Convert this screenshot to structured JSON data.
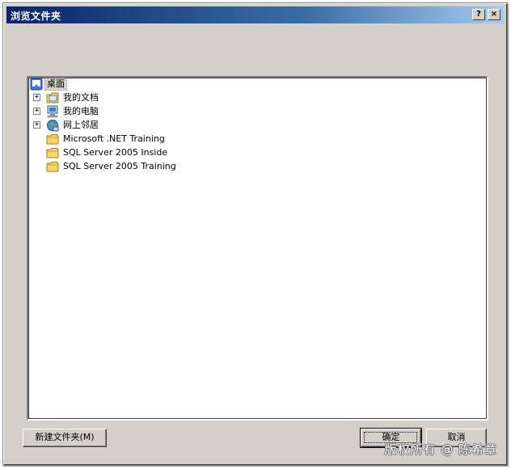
{
  "window": {
    "title": "浏览文件夹",
    "help_label": "?",
    "close_label": "×"
  },
  "tree": {
    "root": {
      "label": "桌面",
      "icon": "desktop-icon"
    },
    "items": [
      {
        "label": "我的文档",
        "icon": "my-documents-icon",
        "expandable": true,
        "expander": "+"
      },
      {
        "label": "我的电脑",
        "icon": "my-computer-icon",
        "expandable": true,
        "expander": "+"
      },
      {
        "label": "网上邻居",
        "icon": "network-places-icon",
        "expandable": true,
        "expander": "+"
      },
      {
        "label": "Microsoft .NET Training",
        "icon": "folder-icon",
        "expandable": false
      },
      {
        "label": "SQL Server 2005 Inside",
        "icon": "folder-icon",
        "expandable": false
      },
      {
        "label": "SQL Server 2005 Training",
        "icon": "folder-icon",
        "expandable": false
      }
    ]
  },
  "buttons": {
    "new_folder": "新建文件夹(M)",
    "ok": "确定",
    "cancel": "取消"
  },
  "watermark": "版权所有 @ 陈希章",
  "colors": {
    "dialog_face": "#d4d0c8",
    "titlebar_start": "#0a246a",
    "titlebar_end": "#a6caf0",
    "folder": "#f5d56a"
  }
}
